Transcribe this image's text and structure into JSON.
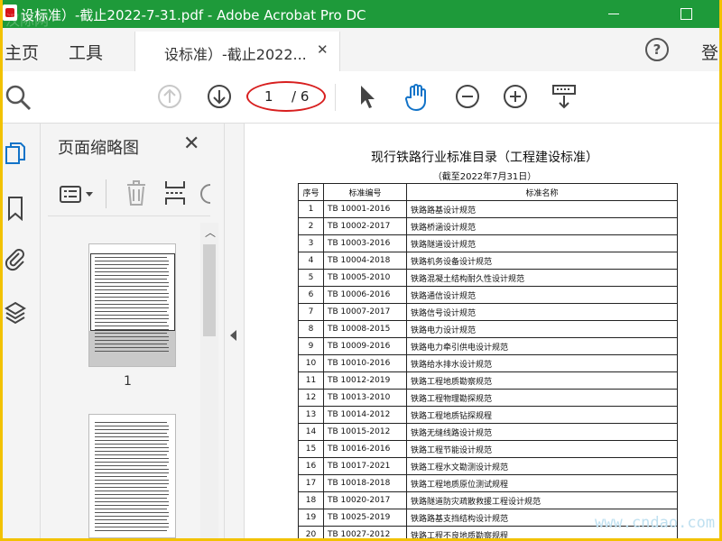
{
  "window": {
    "title": "设标准）-截止2022-7-31.pdf - Adobe Acrobat Pro DC"
  },
  "tabs": {
    "home_label": "主页",
    "tools_label": "工具",
    "doc_tab_label": "设标准）-截止2022...",
    "login_label": "登"
  },
  "toolbar": {
    "page_current": "1",
    "page_total": "/ 6"
  },
  "panel": {
    "title": "页面缩略图",
    "thumb1_label": "1"
  },
  "document": {
    "title": "现行铁路行业标准目录（工程建设标准）",
    "subtitle": "（截至2022年7月31日）",
    "headers": [
      "序号",
      "标准编号",
      "标准名称"
    ],
    "rows": [
      [
        "1",
        "TB 10001-2016",
        "铁路路基设计规范"
      ],
      [
        "2",
        "TB 10002-2017",
        "铁路桥涵设计规范"
      ],
      [
        "3",
        "TB 10003-2016",
        "铁路隧道设计规范"
      ],
      [
        "4",
        "TB 10004-2018",
        "铁路机务设备设计规范"
      ],
      [
        "5",
        "TB 10005-2010",
        "铁路混凝土结构耐久性设计规范"
      ],
      [
        "6",
        "TB 10006-2016",
        "铁路通信设计规范"
      ],
      [
        "7",
        "TB 10007-2017",
        "铁路信号设计规范"
      ],
      [
        "8",
        "TB 10008-2015",
        "铁路电力设计规范"
      ],
      [
        "9",
        "TB 10009-2016",
        "铁路电力牵引供电设计规范"
      ],
      [
        "10",
        "TB 10010-2016",
        "铁路给水排水设计规范"
      ],
      [
        "11",
        "TB 10012-2019",
        "铁路工程地质勘察规范"
      ],
      [
        "12",
        "TB 10013-2010",
        "铁路工程物理勘探规范"
      ],
      [
        "13",
        "TB 10014-2012",
        "铁路工程地质钻探规程"
      ],
      [
        "14",
        "TB 10015-2012",
        "铁路无缝线路设计规范"
      ],
      [
        "15",
        "TB 10016-2016",
        "铁路工程节能设计规范"
      ],
      [
        "16",
        "TB 10017-2021",
        "铁路工程水文勘测设计规范"
      ],
      [
        "17",
        "TB 10018-2018",
        "铁路工程地质原位测试规程"
      ],
      [
        "18",
        "TB 10020-2017",
        "铁路隧道防灾疏散救援工程设计规范"
      ],
      [
        "19",
        "TB 10025-2019",
        "铁路路基支挡结构设计规范"
      ],
      [
        "20",
        "TB 10027-2012",
        "铁路工程不良地质勘察规程"
      ]
    ]
  },
  "watermarks": {
    "top_left": "汉际网",
    "bottom_right": "www.cndao.com"
  },
  "colors": {
    "titlebar": "#1e9a3a",
    "page_highlight": "#d81f1f",
    "outer_frame": "#f2c200"
  }
}
